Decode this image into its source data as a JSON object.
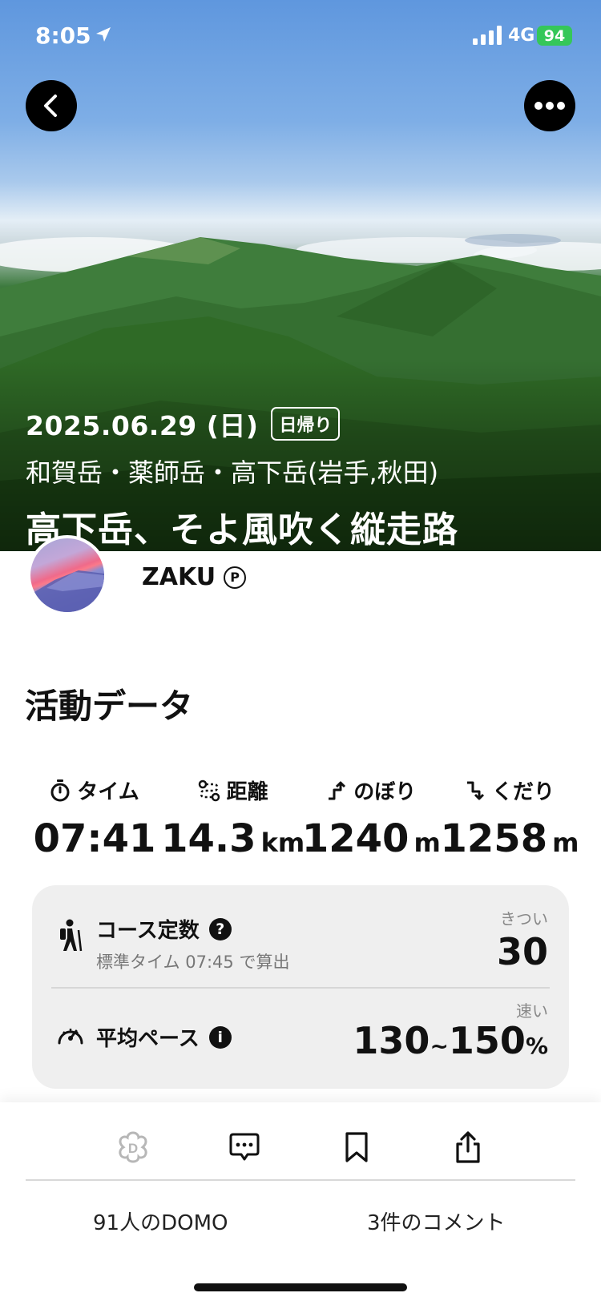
{
  "status_bar": {
    "time": "8:05",
    "network": "4G",
    "battery": "94"
  },
  "hero": {
    "date": "2025.06.29 (日)",
    "trip_type": "日帰り",
    "mountains": "和賀岳・薬師岳・高下岳(岩手,秋田)",
    "title": "高下岳、そよ風吹く縦走路"
  },
  "user": {
    "name": "ZAKU",
    "badge": "P"
  },
  "activity": {
    "section_title": "活動データ",
    "stats": [
      {
        "label": "タイム",
        "value": "07:41",
        "unit": "",
        "icon": "stopwatch-icon"
      },
      {
        "label": "距離",
        "value": "14.3",
        "unit": "km",
        "icon": "route-icon"
      },
      {
        "label": "のぼり",
        "value": "1240",
        "unit": "m",
        "icon": "ascent-icon"
      },
      {
        "label": "くだり",
        "value": "1258",
        "unit": "m",
        "icon": "descent-icon"
      }
    ]
  },
  "course": {
    "title": "コース定数",
    "subtitle": "標準タイム 07:45 で算出",
    "caption": "きつい",
    "value": "30"
  },
  "pace": {
    "title": "平均ペース",
    "caption": "速い",
    "value_low": "130",
    "tilde": "~",
    "value_high": "150",
    "unit": "%"
  },
  "footer": {
    "domo_count": "91人のDOMO",
    "comment_count": "3件のコメント"
  },
  "colors": {
    "accent_battery": "#35c759",
    "card_bg": "#efefef"
  }
}
